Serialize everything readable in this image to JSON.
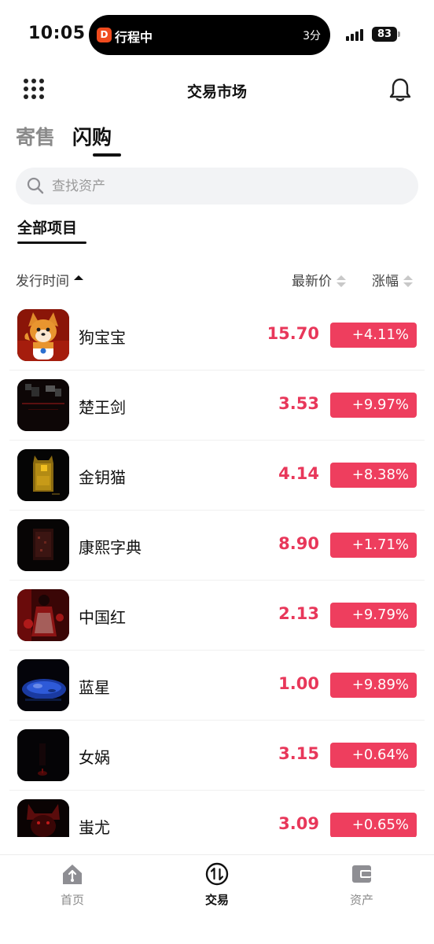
{
  "status_bar": {
    "time": "10:05",
    "live_activity": {
      "title": "行程中",
      "remaining": "3分",
      "app_icon": "didi-icon"
    },
    "battery": "83",
    "icons": [
      "signal-icon",
      "battery-icon"
    ]
  },
  "header": {
    "title": "交易市场",
    "left_icon": "grid-menu-icon",
    "right_icon": "bell-icon"
  },
  "tabs": [
    {
      "label": "寄售",
      "active": false
    },
    {
      "label": "闪购",
      "active": true
    }
  ],
  "search": {
    "placeholder": "查找资产",
    "value": "",
    "icon": "search-icon"
  },
  "filter": {
    "label": "全部项目"
  },
  "columns": {
    "issue_time": "发行时间",
    "latest_price": "最新价",
    "change": "涨幅"
  },
  "items": [
    {
      "name": "狗宝宝",
      "price": "15.70",
      "change": "+4.11%",
      "thumb": "corgi-image"
    },
    {
      "name": "楚王剑",
      "price": "3.53",
      "change": "+9.97%",
      "thumb": "sword-image"
    },
    {
      "name": "金钥猫",
      "price": "4.14",
      "change": "+8.38%",
      "thumb": "lucky-cat-image"
    },
    {
      "name": "康熙字典",
      "price": "8.90",
      "change": "+1.71%",
      "thumb": "dictionary-image"
    },
    {
      "name": "中国红",
      "price": "2.13",
      "change": "+9.79%",
      "thumb": "china-red-image"
    },
    {
      "name": "蓝星",
      "price": "1.00",
      "change": "+9.89%",
      "thumb": "blue-planet-image"
    },
    {
      "name": "女娲",
      "price": "3.15",
      "change": "+0.64%",
      "thumb": "nuwa-image"
    },
    {
      "name": "蚩尤",
      "price": "3.09",
      "change": "+0.65%",
      "thumb": "chiyou-image"
    }
  ],
  "bottom_nav": [
    {
      "label": "首页",
      "icon": "home-icon",
      "active": false
    },
    {
      "label": "交易",
      "icon": "trade-icon",
      "active": true
    },
    {
      "label": "资产",
      "icon": "wallet-icon",
      "active": false
    }
  ],
  "colors": {
    "price_red": "#e8375a",
    "badge_red": "#ee3e5e",
    "search_bg": "#f2f3f5"
  }
}
